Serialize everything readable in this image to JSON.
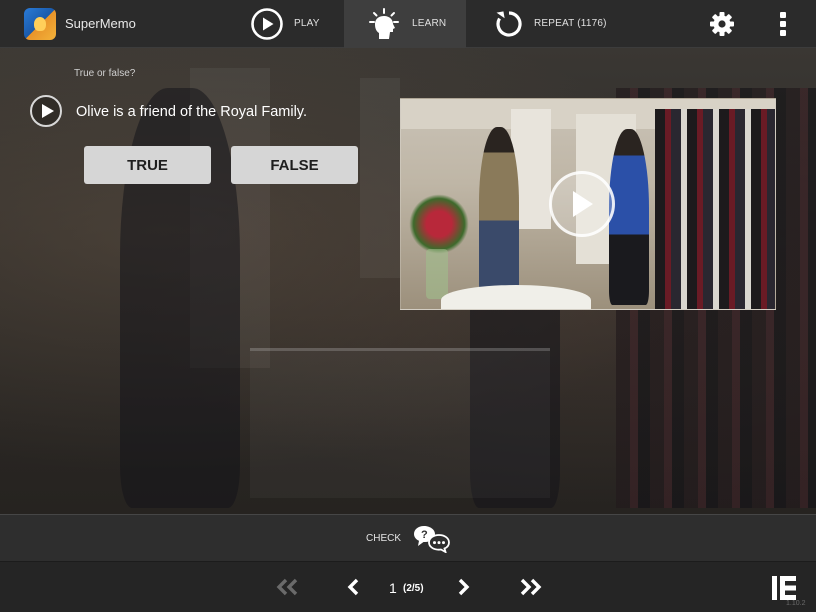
{
  "app": {
    "name": "SuperMemo"
  },
  "nav": {
    "play_label": "PLAY",
    "learn_label": "LEARN",
    "repeat_label": "REPEAT",
    "repeat_count": "(1176)"
  },
  "exercise": {
    "prompt": "True or false?",
    "question": "Olive is a friend of the Royal Family.",
    "answers": [
      "TRUE",
      "FALSE"
    ]
  },
  "check": {
    "label": "CHECK"
  },
  "pager": {
    "current": "1",
    "of": "(2/5)"
  },
  "version": "1.10.2",
  "icons": {
    "play": "play-circle-icon",
    "learn": "lightbulb-head-icon",
    "repeat": "refresh-icon",
    "settings": "gear-icon",
    "menu": "kebab-menu-icon",
    "audio": "audio-play-icon",
    "video": "video-play-icon",
    "check": "chat-bubbles-icon",
    "first": "double-chevron-left-icon",
    "prev": "chevron-left-icon",
    "next": "chevron-right-icon",
    "last": "double-chevron-right-icon",
    "toggle": "sidebar-toggle-icon"
  },
  "colors": {
    "topbar": "#2b2b2b",
    "active_tab": "#3e3e3e",
    "answer_button": "#d6d6d6",
    "answer_text": "#1e1e1e"
  }
}
